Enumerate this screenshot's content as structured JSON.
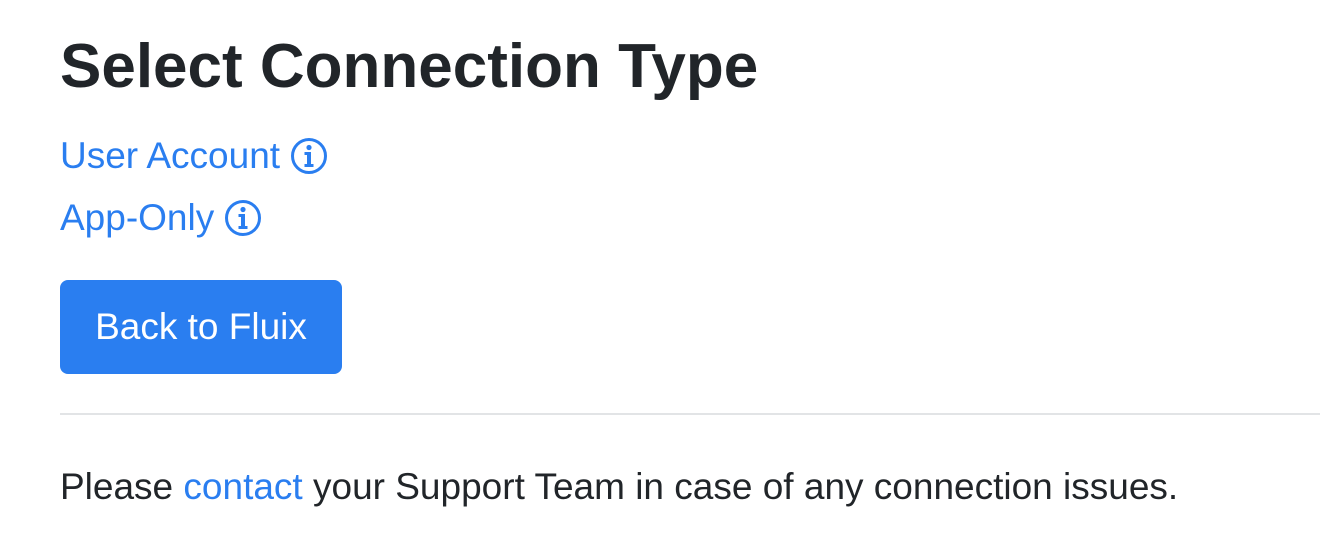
{
  "page": {
    "title": "Select Connection Type"
  },
  "options": [
    {
      "label": "User Account",
      "icon": "info-circle-icon"
    },
    {
      "label": "App-Only",
      "icon": "info-circle-icon"
    }
  ],
  "back_button": {
    "label": "Back to Fluix"
  },
  "footer": {
    "prefix": "Please ",
    "link_text": "contact",
    "suffix": " your Support Team in case of any connection issues."
  },
  "colors": {
    "accent": "#2a7ef0",
    "text": "#212529",
    "divider": "#e2e4e6"
  }
}
